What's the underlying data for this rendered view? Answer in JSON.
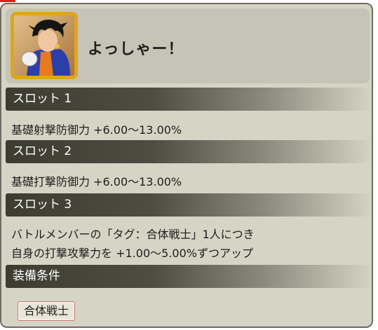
{
  "header": {
    "title": "よっしゃー！"
  },
  "slots": [
    {
      "label": "スロット 1",
      "lines": [
        "基礎射撃防御力 +6.00〜13.00%"
      ]
    },
    {
      "label": "スロット 2",
      "lines": [
        "基礎打撃防御力 +6.00〜13.00%"
      ]
    },
    {
      "label": "スロット 3",
      "lines": [
        "バトルメンバーの「タグ：合体戦士」1人につき",
        "自身の打撃攻撃力を +1.00〜5.00%ずつアップ"
      ]
    }
  ],
  "equip": {
    "label": "装備条件",
    "tag": "合体戦士"
  },
  "icons": {
    "character_portrait": "character-portrait-icon"
  },
  "colors": {
    "panel_bg": "#d6d4c4",
    "header_bg": "#c6c4b6",
    "bar_dark": "#3c3c30",
    "frame_gold": "#e0a51c",
    "tag_border": "#c77b7b"
  }
}
